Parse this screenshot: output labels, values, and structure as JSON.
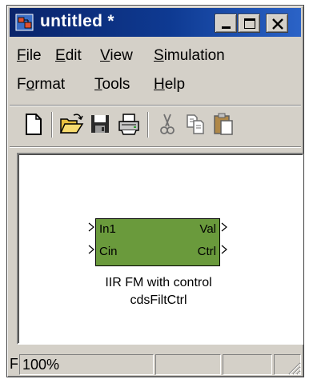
{
  "window": {
    "title": "untitled *",
    "app_icon": "simulink-model-icon",
    "controls": [
      "minimize-icon",
      "maximize-icon",
      "close-icon"
    ]
  },
  "menu": {
    "file": {
      "mnemonic": "F",
      "rest": "ile"
    },
    "edit": {
      "mnemonic": "E",
      "rest": "dit"
    },
    "view": {
      "mnemonic": "V",
      "rest": "iew"
    },
    "simulation": {
      "mnemonic": "S",
      "rest": "imulation"
    },
    "format": {
      "before": "F",
      "mnemonic": "o",
      "rest": "rmat"
    },
    "tools": {
      "mnemonic": "T",
      "rest": "ools"
    },
    "help": {
      "mnemonic": "H",
      "rest": "elp"
    }
  },
  "toolbar": {
    "icons": [
      "new-document-icon",
      "open-folder-icon",
      "save-icon",
      "print-icon",
      "cut-icon",
      "copy-icon",
      "paste-icon"
    ]
  },
  "block": {
    "inputs": [
      "In1",
      "Cin"
    ],
    "outputs": [
      "Val",
      "Ctrl"
    ],
    "caption_line1": "IIR FM with control",
    "caption_line2": "cdsFiltCtrl",
    "color": "#6a9a3c"
  },
  "status": {
    "left": "F",
    "zoom": "100%"
  },
  "colors": {
    "title_bar": "#0a246a",
    "chrome": "#d4d0c8"
  }
}
